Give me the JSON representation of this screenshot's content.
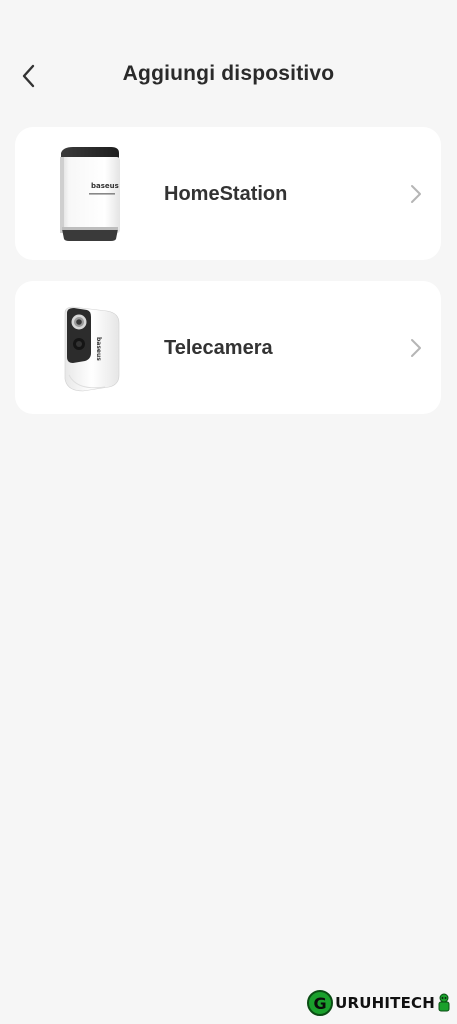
{
  "header": {
    "title": "Aggiungi dispositivo",
    "back_icon": "chevron-left-icon"
  },
  "devices": [
    {
      "name": "HomeStation",
      "image": "homestation-device-image",
      "brand_text": "baseus"
    },
    {
      "name": "Telecamera",
      "image": "camera-device-image",
      "brand_text": "baseus"
    }
  ],
  "watermark": {
    "letter": "G",
    "text": "URUHITECH"
  },
  "colors": {
    "background": "#f6f6f6",
    "card": "#ffffff",
    "title_text": "#2a2a2a",
    "chevron": "#b5b5b5",
    "watermark_green": "#1aa02c"
  }
}
